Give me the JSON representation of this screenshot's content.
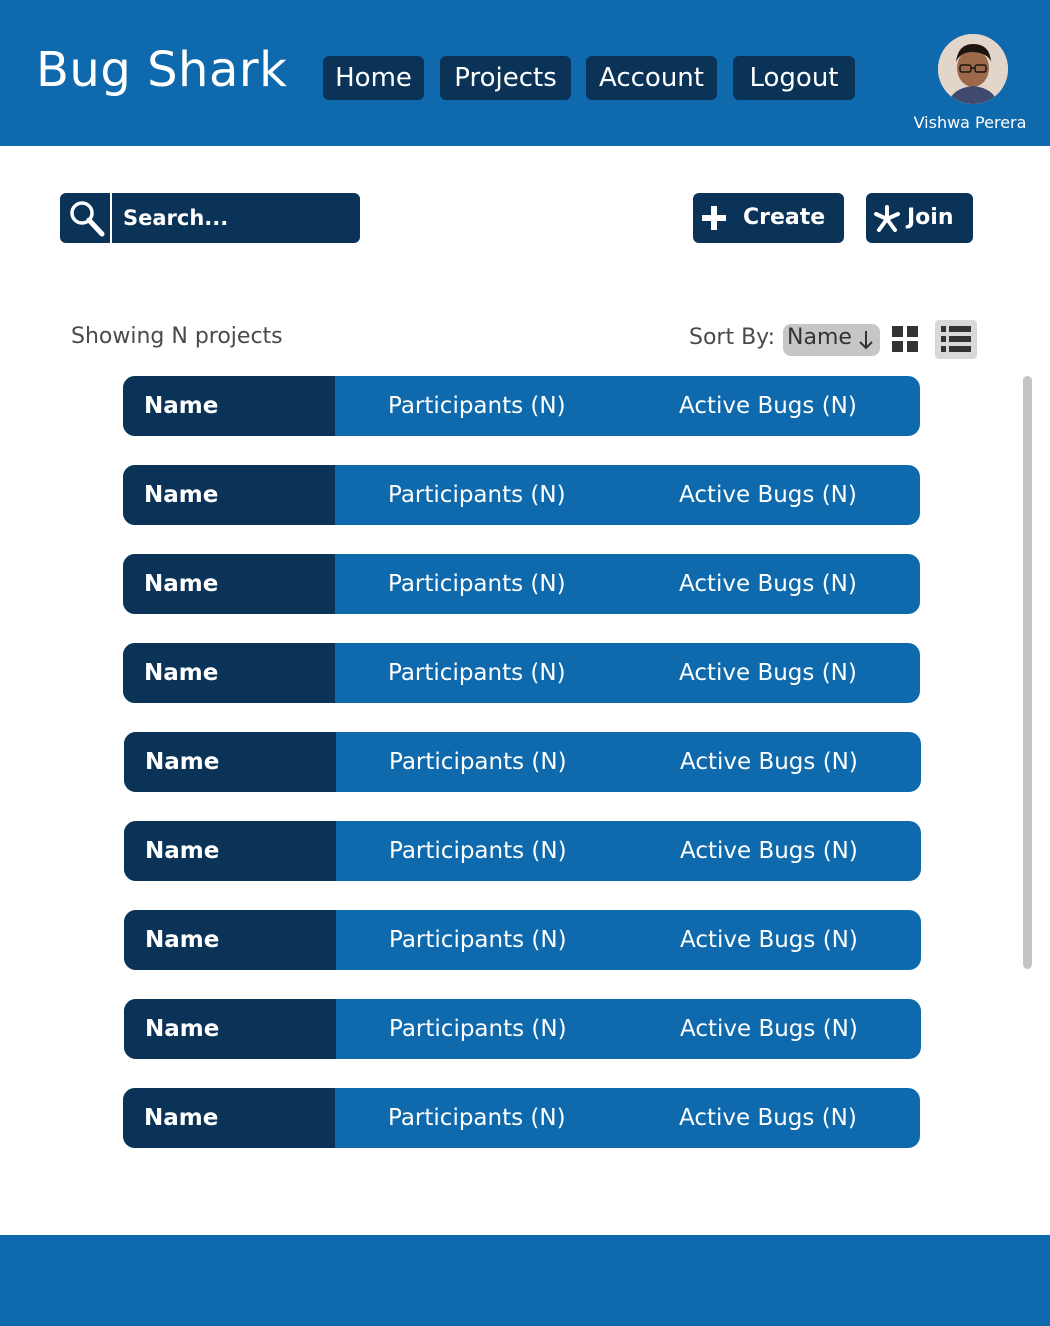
{
  "app": {
    "brand": "Bug Shark"
  },
  "nav": {
    "items": [
      {
        "label": "Home"
      },
      {
        "label": "Projects"
      },
      {
        "label": "Account"
      },
      {
        "label": "Logout"
      }
    ]
  },
  "user": {
    "name": "Vishwa Perera"
  },
  "toolbar": {
    "search_placeholder": "Search...",
    "create_label": "Create",
    "join_label": "Join"
  },
  "list_header": {
    "showing_text": "Showing N projects",
    "sort_label": "Sort By:",
    "sort_value": "Name",
    "sort_direction": "descending"
  },
  "projects": [
    {
      "name": "Name",
      "participants": "Participants (N)",
      "bugs": "Active Bugs (N)"
    },
    {
      "name": "Name",
      "participants": "Participants (N)",
      "bugs": "Active Bugs (N)"
    },
    {
      "name": "Name",
      "participants": "Participants (N)",
      "bugs": "Active Bugs (N)"
    },
    {
      "name": "Name",
      "participants": "Participants (N)",
      "bugs": "Active Bugs (N)"
    },
    {
      "name": "Name",
      "participants": "Participants (N)",
      "bugs": "Active Bugs (N)"
    },
    {
      "name": "Name",
      "participants": "Participants (N)",
      "bugs": "Active Bugs (N)"
    },
    {
      "name": "Name",
      "participants": "Participants (N)",
      "bugs": "Active Bugs (N)"
    },
    {
      "name": "Name",
      "participants": "Participants (N)",
      "bugs": "Active Bugs (N)"
    },
    {
      "name": "Name",
      "participants": "Participants (N)",
      "bugs": "Active Bugs (N)"
    }
  ],
  "colors": {
    "primary": "#0e69ad",
    "dark": "#0b3357",
    "sort_bg": "#c6c6c6"
  },
  "icons": {
    "search": "search-icon",
    "create": "plus-icon",
    "join": "asterisk-icon",
    "grid": "grid-view-icon",
    "list": "list-view-icon",
    "sort": "arrow-down-icon"
  },
  "view_mode": "list"
}
